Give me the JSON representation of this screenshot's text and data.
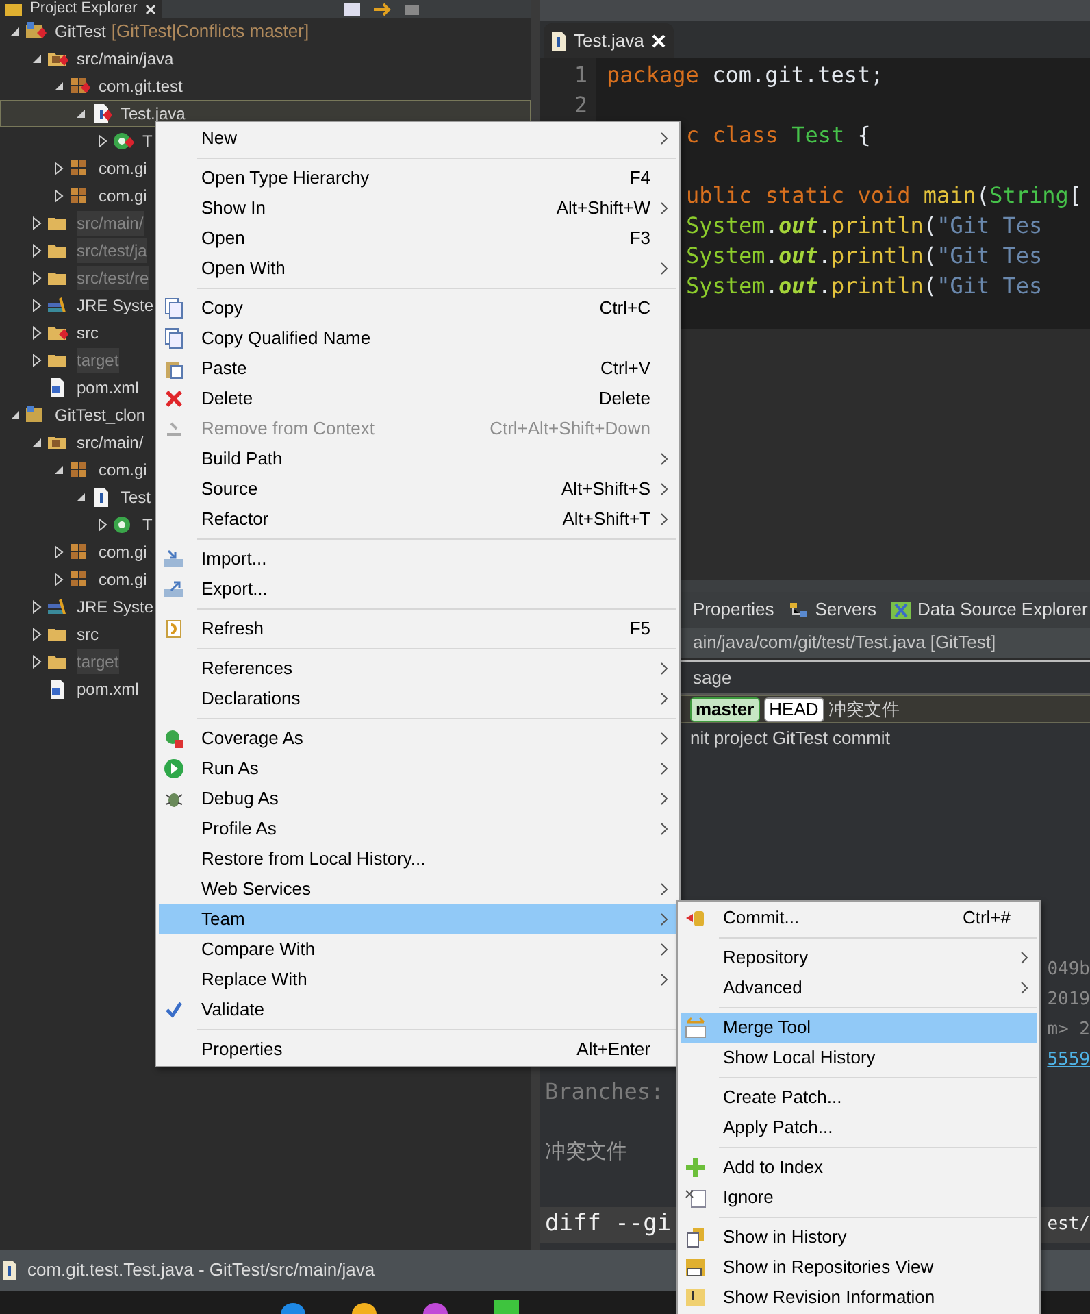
{
  "explorer": {
    "title": "Project Explorer",
    "tree": [
      {
        "label": "GitTest",
        "decoration": "[GitTest|Conflicts master]",
        "kind": "project",
        "conflict": true,
        "expanded": true,
        "selected": false,
        "greyed": false,
        "children": [
          {
            "label": "src/main/java",
            "kind": "source",
            "conflict": true,
            "expanded": true,
            "selected": false,
            "greyed": false,
            "children": [
              {
                "label": "com.git.test",
                "kind": "package",
                "conflict": true,
                "expanded": true,
                "selected": false,
                "greyed": false,
                "children": [
                  {
                    "label": "Test.java",
                    "kind": "java",
                    "conflict": true,
                    "expanded": true,
                    "selected": true,
                    "greyed": false,
                    "children": [
                      {
                        "label": "T",
                        "kind": "class",
                        "conflict": true,
                        "expanded": false,
                        "selected": false,
                        "greyed": false
                      }
                    ]
                  }
                ]
              },
              {
                "label": "com.gi",
                "kind": "package",
                "conflict": false,
                "expanded": false,
                "selected": false,
                "greyed": false
              },
              {
                "label": "com.gi",
                "kind": "package",
                "conflict": false,
                "expanded": false,
                "selected": false,
                "greyed": false
              }
            ]
          },
          {
            "label": "src/main/",
            "kind": "folder",
            "conflict": false,
            "expanded": false,
            "selected": false,
            "greyed": true
          },
          {
            "label": "src/test/ja",
            "kind": "folder",
            "conflict": false,
            "expanded": false,
            "selected": false,
            "greyed": true
          },
          {
            "label": "src/test/re",
            "kind": "folder",
            "conflict": false,
            "expanded": false,
            "selected": false,
            "greyed": true
          },
          {
            "label": "JRE Syste",
            "kind": "library",
            "conflict": false,
            "expanded": false,
            "selected": false,
            "greyed": false
          },
          {
            "label": "src",
            "kind": "folder",
            "conflict": true,
            "expanded": false,
            "selected": false,
            "greyed": false
          },
          {
            "label": "target",
            "kind": "folder",
            "conflict": false,
            "expanded": false,
            "selected": false,
            "greyed": true
          },
          {
            "label": "pom.xml",
            "kind": "xml",
            "conflict": false,
            "selected": false,
            "greyed": false
          }
        ]
      },
      {
        "label": "GitTest_clon",
        "kind": "project",
        "conflict": false,
        "expanded": true,
        "selected": false,
        "greyed": false,
        "children": [
          {
            "label": "src/main/",
            "kind": "source",
            "conflict": false,
            "expanded": true,
            "selected": false,
            "greyed": false,
            "children": [
              {
                "label": "com.gi",
                "kind": "package",
                "conflict": false,
                "expanded": true,
                "selected": false,
                "greyed": false,
                "children": [
                  {
                    "label": "Test",
                    "kind": "java",
                    "conflict": false,
                    "expanded": true,
                    "selected": false,
                    "greyed": false,
                    "children": [
                      {
                        "label": "T",
                        "kind": "class",
                        "conflict": false,
                        "expanded": false,
                        "selected": false,
                        "greyed": false
                      }
                    ]
                  }
                ]
              },
              {
                "label": "com.gi",
                "kind": "package",
                "conflict": false,
                "expanded": false,
                "selected": false,
                "greyed": false
              },
              {
                "label": "com.gi",
                "kind": "package",
                "conflict": false,
                "expanded": false,
                "selected": false,
                "greyed": false
              }
            ]
          },
          {
            "label": "JRE Syste",
            "kind": "library",
            "conflict": false,
            "expanded": false,
            "selected": false,
            "greyed": false
          },
          {
            "label": "src",
            "kind": "folder",
            "conflict": false,
            "expanded": false,
            "selected": false,
            "greyed": false
          },
          {
            "label": "target",
            "kind": "folder",
            "conflict": false,
            "expanded": false,
            "selected": false,
            "greyed": true
          },
          {
            "label": "pom.xml",
            "kind": "xml",
            "conflict": false,
            "selected": false,
            "greyed": false
          }
        ]
      }
    ]
  },
  "editor": {
    "tab": "Test.java",
    "lines": [
      {
        "number": "1",
        "tokens": [
          {
            "text": "package",
            "kind": "keyword"
          },
          {
            "text": " com.git.test;",
            "kind": "plain"
          }
        ]
      },
      {
        "number": "2"
      },
      {
        "tokens": [
          {
            "text": "c class",
            "kind": "keyword"
          },
          {
            "text": " Test",
            "kind": "type"
          },
          {
            "text": " {",
            "kind": "plain"
          }
        ]
      },
      {
        "tokens": [
          {
            "text": "ublic static void",
            "kind": "keyword"
          },
          {
            "text": " main",
            "kind": "method"
          },
          {
            "text": "(",
            "kind": "plain"
          },
          {
            "text": "String",
            "kind": "type"
          },
          {
            "text": "[",
            "kind": "plain"
          }
        ]
      },
      {
        "tokens": [
          {
            "text": "System",
            "kind": "class"
          },
          {
            "text": ".",
            "kind": "plain"
          },
          {
            "text": "out",
            "kind": "field"
          },
          {
            "text": ".",
            "kind": "plain"
          },
          {
            "text": "println",
            "kind": "method"
          },
          {
            "text": "(",
            "kind": "plain"
          },
          {
            "text": "\"Git Tes",
            "kind": "string"
          }
        ]
      },
      {
        "tokens": [
          {
            "text": "System",
            "kind": "class"
          },
          {
            "text": ".",
            "kind": "plain"
          },
          {
            "text": "out",
            "kind": "field"
          },
          {
            "text": ".",
            "kind": "plain"
          },
          {
            "text": "println",
            "kind": "method"
          },
          {
            "text": "(",
            "kind": "plain"
          },
          {
            "text": "\"Git Tes",
            "kind": "string"
          }
        ]
      },
      {
        "tokens": [
          {
            "text": "System",
            "kind": "class"
          },
          {
            "text": ".",
            "kind": "plain"
          },
          {
            "text": "out",
            "kind": "field"
          },
          {
            "text": ".",
            "kind": "plain"
          },
          {
            "text": "println",
            "kind": "method"
          },
          {
            "text": "(",
            "kind": "plain"
          },
          {
            "text": "\"Git Tes",
            "kind": "string"
          }
        ]
      }
    ]
  },
  "bottom_panel": {
    "tabs": [
      {
        "label": "Properties",
        "kind": "properties"
      },
      {
        "label": "Servers",
        "kind": "servers"
      },
      {
        "label": "Data Source Explorer",
        "kind": "datasource"
      }
    ],
    "path": "ain/java/com/git/test/Test.java [GitTest]",
    "column_header": "sage",
    "rows": [
      {
        "selected": true,
        "badges": [
          {
            "label": "master",
            "kind": "branch"
          },
          {
            "label": "HEAD",
            "kind": "head"
          }
        ],
        "text": "冲突文件"
      },
      {
        "selected": false,
        "badges": [],
        "text": "nit project GitTest commit"
      }
    ],
    "details": [
      {
        "text": "049b",
        "kind": "plain"
      },
      {
        "text": "2019",
        "kind": "plain"
      },
      {
        "text": "m> 2",
        "kind": "plain"
      },
      {
        "text": "5559",
        "kind": "link"
      }
    ],
    "branches_label": "Branches:",
    "message": "冲突文件",
    "diff": "diff --gi",
    "diff_tail": "est/"
  },
  "context_menu": {
    "items": [
      {
        "kind": "item",
        "label": "New",
        "submenu": true,
        "disabled": false,
        "selected": false,
        "checked": false
      },
      {
        "kind": "separator"
      },
      {
        "kind": "item",
        "label": "Open Type Hierarchy",
        "shortcut": "F4",
        "submenu": false,
        "disabled": false,
        "selected": false,
        "checked": false
      },
      {
        "kind": "item",
        "label": "Show In",
        "shortcut": "Alt+Shift+W",
        "submenu": true,
        "disabled": false,
        "selected": false,
        "checked": false
      },
      {
        "kind": "item",
        "label": "Open",
        "shortcut": "F3",
        "submenu": false,
        "disabled": false,
        "selected": false,
        "checked": false
      },
      {
        "kind": "item",
        "label": "Open With",
        "submenu": true,
        "disabled": false,
        "selected": false,
        "checked": false
      },
      {
        "kind": "separator"
      },
      {
        "kind": "item",
        "label": "Copy",
        "shortcut": "Ctrl+C",
        "submenu": false,
        "disabled": false,
        "selected": false,
        "checked": false
      },
      {
        "kind": "item",
        "label": "Copy Qualified Name",
        "submenu": false,
        "disabled": false,
        "selected": false,
        "checked": false
      },
      {
        "kind": "item",
        "label": "Paste",
        "shortcut": "Ctrl+V",
        "submenu": false,
        "disabled": false,
        "selected": false,
        "checked": false
      },
      {
        "kind": "item",
        "label": "Delete",
        "shortcut": "Delete",
        "submenu": false,
        "disabled": false,
        "selected": false,
        "checked": false
      },
      {
        "kind": "item",
        "label": "Remove from Context",
        "shortcut": "Ctrl+Alt+Shift+Down",
        "submenu": false,
        "disabled": true,
        "selected": false,
        "checked": false
      },
      {
        "kind": "item",
        "label": "Build Path",
        "submenu": true,
        "disabled": false,
        "selected": false,
        "checked": false
      },
      {
        "kind": "item",
        "label": "Source",
        "shortcut": "Alt+Shift+S",
        "submenu": true,
        "disabled": false,
        "selected": false,
        "checked": false
      },
      {
        "kind": "item",
        "label": "Refactor",
        "shortcut": "Alt+Shift+T",
        "submenu": true,
        "disabled": false,
        "selected": false,
        "checked": false
      },
      {
        "kind": "separator"
      },
      {
        "kind": "item",
        "label": "Import...",
        "submenu": false,
        "disabled": false,
        "selected": false,
        "checked": false
      },
      {
        "kind": "item",
        "label": "Export...",
        "submenu": false,
        "disabled": false,
        "selected": false,
        "checked": false
      },
      {
        "kind": "separator"
      },
      {
        "kind": "item",
        "label": "Refresh",
        "shortcut": "F5",
        "submenu": false,
        "disabled": false,
        "selected": false,
        "checked": false
      },
      {
        "kind": "separator"
      },
      {
        "kind": "item",
        "label": "References",
        "submenu": true,
        "disabled": false,
        "selected": false,
        "checked": false
      },
      {
        "kind": "item",
        "label": "Declarations",
        "submenu": true,
        "disabled": false,
        "selected": false,
        "checked": false
      },
      {
        "kind": "separator"
      },
      {
        "kind": "item",
        "label": "Coverage As",
        "submenu": true,
        "disabled": false,
        "selected": false,
        "checked": false
      },
      {
        "kind": "item",
        "label": "Run As",
        "submenu": true,
        "disabled": false,
        "selected": false,
        "checked": false
      },
      {
        "kind": "item",
        "label": "Debug As",
        "submenu": true,
        "disabled": false,
        "selected": false,
        "checked": false
      },
      {
        "kind": "item",
        "label": "Profile As",
        "submenu": true,
        "disabled": false,
        "selected": false,
        "checked": false
      },
      {
        "kind": "item",
        "label": "Restore from Local History...",
        "submenu": false,
        "disabled": false,
        "selected": false,
        "checked": false
      },
      {
        "kind": "item",
        "label": "Web Services",
        "submenu": true,
        "disabled": false,
        "selected": false,
        "checked": false
      },
      {
        "kind": "item",
        "label": "Team",
        "submenu": true,
        "disabled": false,
        "selected": true,
        "checked": false
      },
      {
        "kind": "item",
        "label": "Compare With",
        "submenu": true,
        "disabled": false,
        "selected": false,
        "checked": false
      },
      {
        "kind": "item",
        "label": "Replace With",
        "submenu": true,
        "disabled": false,
        "selected": false,
        "checked": false
      },
      {
        "kind": "item",
        "label": "Validate",
        "submenu": false,
        "disabled": false,
        "selected": false,
        "checked": true
      },
      {
        "kind": "separator"
      },
      {
        "kind": "item",
        "label": "Properties",
        "shortcut": "Alt+Enter",
        "submenu": false,
        "disabled": false,
        "selected": false,
        "checked": false
      }
    ]
  },
  "team_submenu": {
    "items": [
      {
        "kind": "item",
        "label": "Commit...",
        "shortcut": "Ctrl+#",
        "submenu": false,
        "disabled": false,
        "selected": false,
        "checked": false
      },
      {
        "kind": "separator"
      },
      {
        "kind": "item",
        "label": "Repository",
        "submenu": true,
        "disabled": false,
        "selected": false,
        "checked": false
      },
      {
        "kind": "item",
        "label": "Advanced",
        "submenu": true,
        "disabled": false,
        "selected": false,
        "checked": false
      },
      {
        "kind": "separator"
      },
      {
        "kind": "item",
        "label": "Merge Tool",
        "submenu": false,
        "disabled": false,
        "selected": true,
        "checked": false
      },
      {
        "kind": "item",
        "label": "Show Local History",
        "submenu": false,
        "disabled": false,
        "selected": false,
        "checked": false
      },
      {
        "kind": "separator"
      },
      {
        "kind": "item",
        "label": "Create Patch...",
        "submenu": false,
        "disabled": false,
        "selected": false,
        "checked": false
      },
      {
        "kind": "item",
        "label": "Apply Patch...",
        "submenu": false,
        "disabled": false,
        "selected": false,
        "checked": false
      },
      {
        "kind": "separator"
      },
      {
        "kind": "item",
        "label": "Add to Index",
        "submenu": false,
        "disabled": false,
        "selected": false,
        "checked": false
      },
      {
        "kind": "item",
        "label": "Ignore",
        "submenu": false,
        "disabled": false,
        "selected": false,
        "checked": false
      },
      {
        "kind": "separator"
      },
      {
        "kind": "item",
        "label": "Show in History",
        "submenu": false,
        "disabled": false,
        "selected": false,
        "checked": false
      },
      {
        "kind": "item",
        "label": "Show in Repositories View",
        "submenu": false,
        "disabled": false,
        "selected": false,
        "checked": false
      },
      {
        "kind": "item",
        "label": "Show Revision Information",
        "submenu": false,
        "disabled": false,
        "selected": false,
        "checked": false
      }
    ]
  },
  "status_bar": {
    "text": "com.git.test.Test.java - GitTest/src/main/java"
  }
}
